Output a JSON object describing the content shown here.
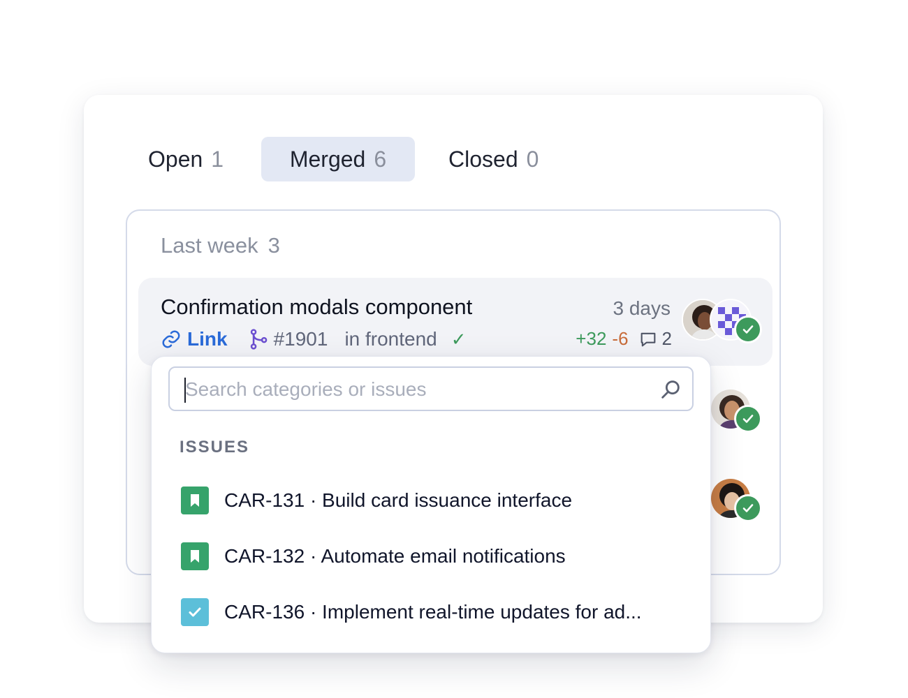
{
  "tabs": [
    {
      "label": "Open",
      "count": "1"
    },
    {
      "label": "Merged",
      "count": "6"
    },
    {
      "label": "Closed",
      "count": "0"
    }
  ],
  "group": {
    "label": "Last week",
    "count": "3"
  },
  "pr": {
    "title": "Confirmation modals component",
    "age": "3 days",
    "link_label": "Link",
    "number": "#1901",
    "repo": "in frontend",
    "added": "+32",
    "removed": "-6",
    "comments": "2"
  },
  "search": {
    "placeholder": "Search categories or issues",
    "value": ""
  },
  "issues_section": {
    "label": "ISSUES"
  },
  "issues": [
    {
      "label": "CAR-131 · Build card issuance interface",
      "icon": "bookmark-icon",
      "color": "#36a36b"
    },
    {
      "label": "CAR-132 · Automate email notifications",
      "icon": "bookmark-icon",
      "color": "#36a36b"
    },
    {
      "label": "CAR-136 · Implement real-time updates for ad...",
      "icon": "checkbox-icon",
      "color": "#5cbfd9"
    }
  ],
  "colors": {
    "accent": "#2a6ad8",
    "success": "#3d9a5c",
    "removed": "#c86c3a",
    "tab_active_bg": "#e3e8f4"
  }
}
